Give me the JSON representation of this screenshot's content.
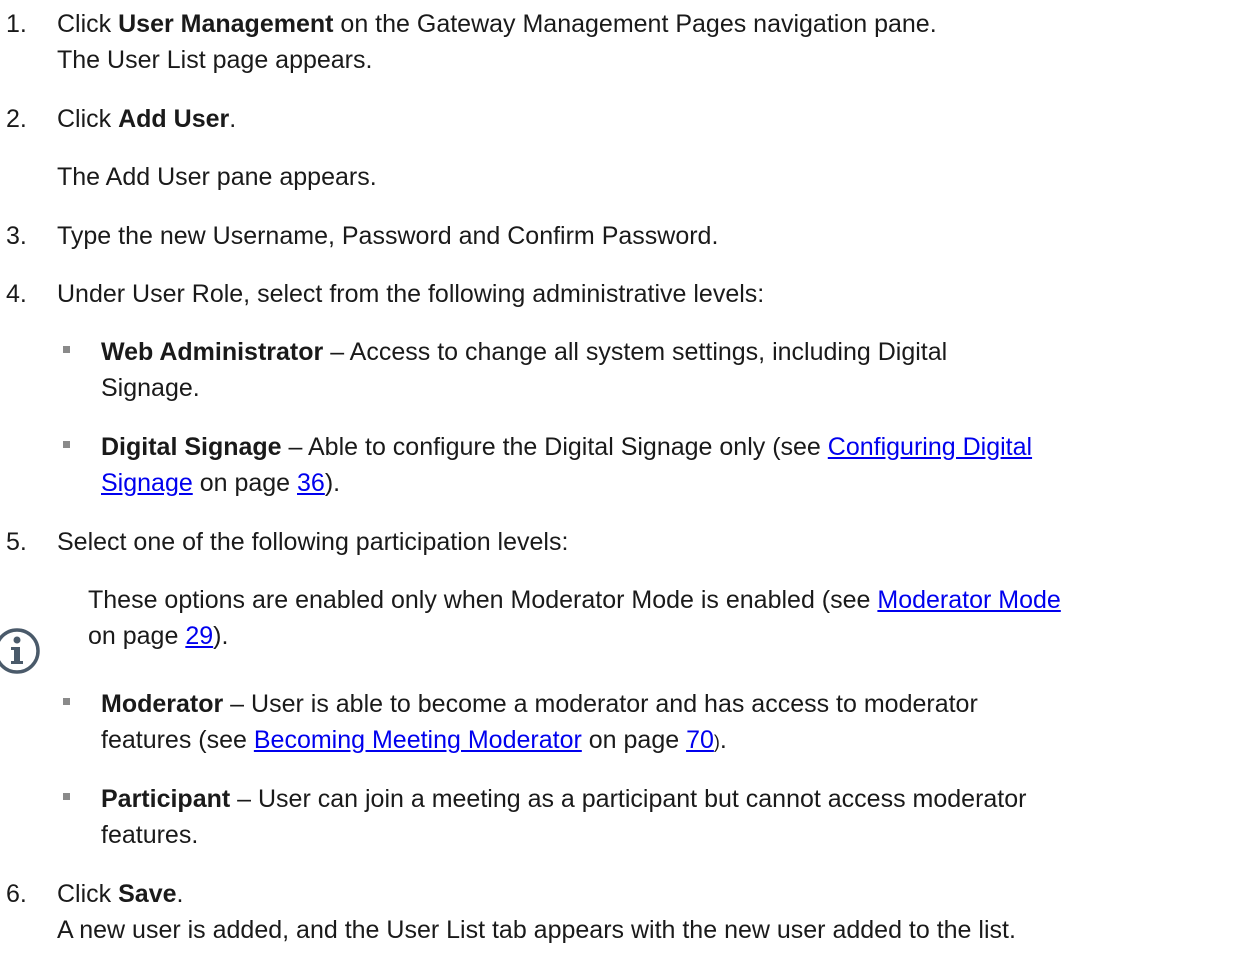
{
  "steps": [
    {
      "num": "1.",
      "pre": "Click ",
      "bold": "User Management",
      "post": " on the Gateway Management Pages navigation pane.",
      "result": "The User List page appears."
    },
    {
      "num": "2.",
      "pre": "Click ",
      "bold": "Add User",
      "post": ".",
      "result": "The Add User pane appears."
    },
    {
      "num": "3.",
      "text": "Type the new Username, Password and Confirm Password."
    },
    {
      "num": "4.",
      "text": "Under User Role, select from the following administrative levels:",
      "bullets": [
        {
          "bold": "Web Administrator",
          "line1": " – Access to change all system settings, including Digital",
          "line2": "Signage."
        },
        {
          "bold": "Digital Signage",
          "line1": " – Able to configure the Digital Signage only (see ",
          "link1": "Configuring Digital",
          "link2": "Signage",
          "mid": " on page ",
          "page": "36",
          "end": ")."
        }
      ]
    },
    {
      "num": "5.",
      "text": "Select one of the following participation levels:",
      "note": {
        "line1": "These options are enabled only when Moderator Mode is enabled (see ",
        "link": "Moderator Mode",
        "pre2": "on page ",
        "page": "29",
        "end": ")."
      },
      "bullets": [
        {
          "bold": "Moderator",
          "line1": " – User is able to become a moderator and has access to moderator",
          "pre2": "features (see ",
          "link": "Becoming Meeting Moderator",
          "mid": " on page ",
          "page": "70",
          "end_small": ")",
          "end": "."
        },
        {
          "bold": "Participant",
          "line1": " – User can join a meeting as a participant but cannot access moderator",
          "line2": "features."
        }
      ]
    },
    {
      "num": "6.",
      "pre": "Click ",
      "bold": "Save",
      "post": ".",
      "result": "A new user is added, and the User List tab appears with the new user added to the list."
    }
  ],
  "colors": {
    "link": "#0000ee",
    "icon": "#4a5a6a",
    "bullet": "#8a8a8a"
  },
  "icons": {
    "note": "info-icon"
  }
}
